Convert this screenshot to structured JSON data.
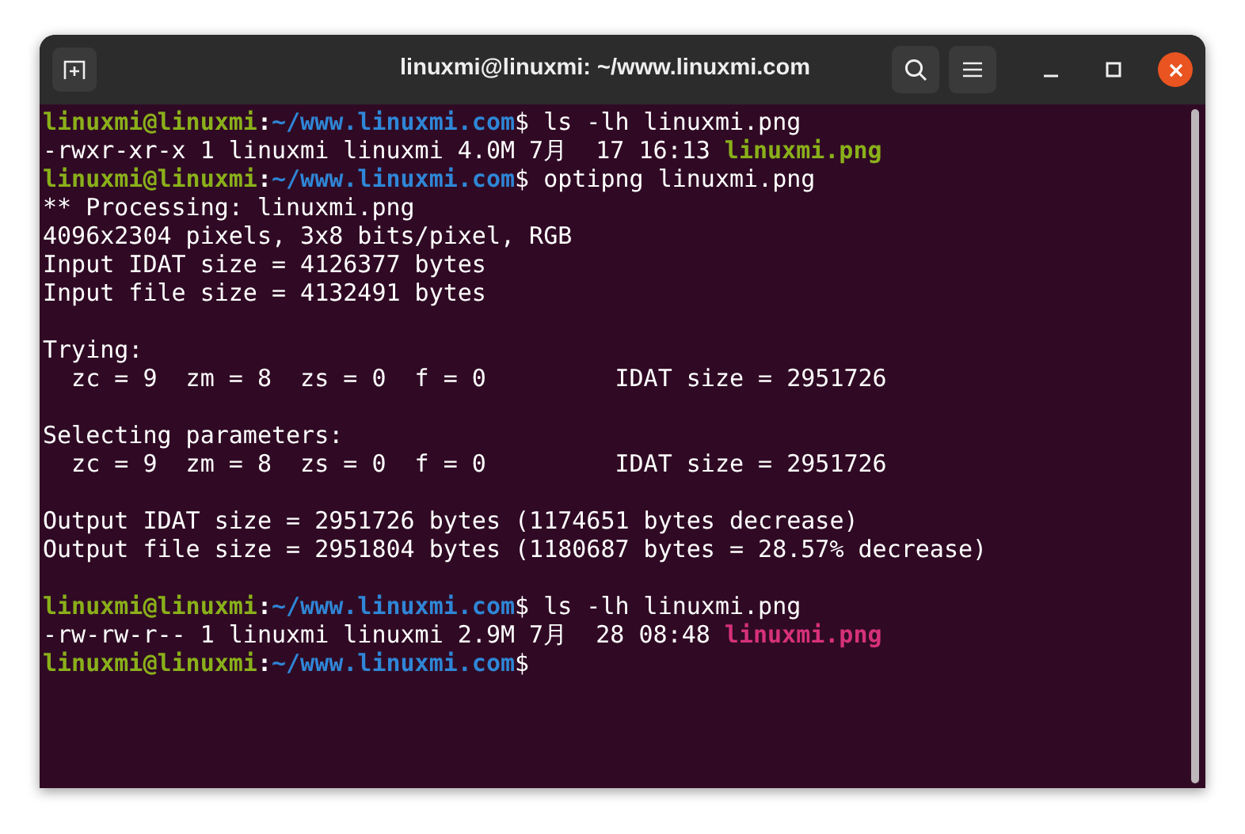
{
  "window": {
    "title": "linuxmi@linuxmi: ~/www.linuxmi.com"
  },
  "terminal": {
    "lines": [
      {
        "kind": "prompt",
        "user": "linuxmi@linuxmi",
        "sep": ":",
        "path": "~/www.linuxmi.com",
        "dollar": "$",
        "command": " ls -lh linuxmi.png"
      },
      {
        "kind": "output",
        "text": "-rwxr-xr-x 1 linuxmi linuxmi 4.0M 7月  17 16:13 ",
        "file": "linuxmi.png",
        "color": "#8ab01a"
      },
      {
        "kind": "prompt",
        "user": "linuxmi@linuxmi",
        "sep": ":",
        "path": "~/www.linuxmi.com",
        "dollar": "$",
        "command": " optipng linuxmi.png"
      },
      {
        "kind": "output",
        "text": "** Processing: linuxmi.png"
      },
      {
        "kind": "output",
        "text": "4096x2304 pixels, 3x8 bits/pixel, RGB"
      },
      {
        "kind": "output",
        "text": "Input IDAT size = 4126377 bytes"
      },
      {
        "kind": "output",
        "text": "Input file size = 4132491 bytes"
      },
      {
        "kind": "blank"
      },
      {
        "kind": "output",
        "text": "Trying:"
      },
      {
        "kind": "output",
        "text": "  zc = 9  zm = 8  zs = 0  f = 0         IDAT size = 2951726"
      },
      {
        "kind": "blank"
      },
      {
        "kind": "output",
        "text": "Selecting parameters:"
      },
      {
        "kind": "output",
        "text": "  zc = 9  zm = 8  zs = 0  f = 0         IDAT size = 2951726"
      },
      {
        "kind": "blank"
      },
      {
        "kind": "output",
        "text": "Output IDAT size = 2951726 bytes (1174651 bytes decrease)"
      },
      {
        "kind": "output",
        "text": "Output file size = 2951804 bytes (1180687 bytes = 28.57% decrease)"
      },
      {
        "kind": "blank"
      },
      {
        "kind": "prompt",
        "user": "linuxmi@linuxmi",
        "sep": ":",
        "path": "~/www.linuxmi.com",
        "dollar": "$",
        "command": " ls -lh linuxmi.png"
      },
      {
        "kind": "output",
        "text": "-rw-rw-r-- 1 linuxmi linuxmi 2.9M 7月  28 08:48 ",
        "file": "linuxmi.png",
        "color": "#d6317a"
      },
      {
        "kind": "prompt",
        "user": "linuxmi@linuxmi",
        "sep": ":",
        "path": "~/www.linuxmi.com",
        "dollar": "$"
      }
    ]
  }
}
